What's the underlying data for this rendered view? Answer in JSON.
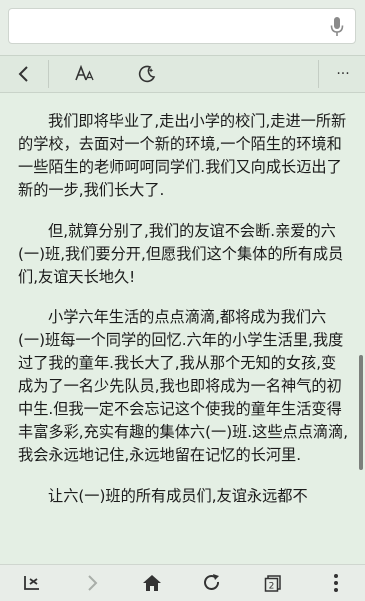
{
  "search": {
    "value": "",
    "placeholder": ""
  },
  "icons": {
    "mic": "microphone-icon",
    "back": "back-arrow-icon",
    "font": "font-size-icon",
    "night": "night-mode-icon",
    "more": "more-horizontal-icon",
    "collapse": "exit-reading-icon",
    "forward": "forward-arrow-icon",
    "home": "home-icon",
    "refresh": "refresh-icon",
    "tabs": "tabs-icon",
    "menu": "more-vertical-icon"
  },
  "toolbar": {
    "more_label": "···"
  },
  "article": {
    "paragraphs": [
      "我们即将毕业了,走出小学的校门,走进一所新的学校，去面对一个新的环境,一个陌生的环境和一些陌生的老师呵呵同学们.我们又向成长迈出了新的一步,我们长大了.",
      "但,就算分别了,我们的友谊不会断.亲爱的六(一)班,我们要分开,但愿我们这个集体的所有成员们,友谊天长地久!",
      "小学六年生活的点点滴滴,都将成为我们六(一)班每一个同学的回忆.六年的小学生活里,我度过了我的童年.我长大了,我从那个无知的女孩,变成为了一名少先队员,我也即将成为一名神气的初中生.但我一定不会忘记这个使我的童年生活变得丰富多彩,充实有趣的集体六(一)班.这些点点滴滴,我会永远地记住,永远地留在记忆的长河里.",
      "让六(一)班的所有成员们,友谊永远都不"
    ]
  },
  "bottom_bar": {
    "tab_count": "2"
  }
}
